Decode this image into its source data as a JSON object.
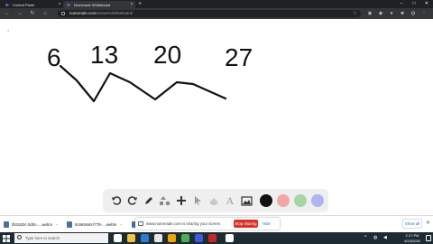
{
  "browser": {
    "tabs": [
      {
        "title": "Control Panel",
        "favicon_color": "#7b5cd6"
      },
      {
        "title": "Numerade Whiteboard",
        "favicon_color": "#7b5cd6"
      }
    ],
    "url_host": "numerade.com",
    "url_path": "/answers/whiteboard/",
    "window_controls": {
      "minimize": "–",
      "maximize": "□",
      "close": "✕"
    }
  },
  "whiteboard": {
    "numbers": [
      "6",
      "13",
      "20",
      "27"
    ],
    "ink_color": "#111111",
    "collapse_chevron": "‹"
  },
  "toolbar": {
    "tools": [
      "undo-icon",
      "redo-icon",
      "pen-icon",
      "shapes-icon",
      "add-icon",
      "select-icon",
      "eraser-icon",
      "text-icon",
      "image-icon"
    ],
    "text_tool_glyph": "A",
    "colors": [
      "#111111",
      "#f2a6a6",
      "#a6d6a6",
      "#b0b4f0"
    ]
  },
  "screen_share": {
    "message": "www.numerade.com is sharing your screen.",
    "stop_label": "Stop sharing",
    "hide_label": "Hide"
  },
  "downloads": {
    "items": [
      "0b10d3c-3d0c-....webm",
      "5c6694a0-f778-....webm",
      "3f66-7979-1"
    ],
    "show_all_label": "Show all"
  },
  "taskbar": {
    "search_placeholder": "Type here to search",
    "time": "2:17 PM",
    "date": "4/13/2020",
    "app_colors": [
      "#ffffff",
      "#f0c14b",
      "#2b7cd3",
      "#e8e8e8",
      "#f0a30a",
      "#4caf50",
      "#3b5bdb",
      "#c62828",
      "#ffffff"
    ]
  }
}
